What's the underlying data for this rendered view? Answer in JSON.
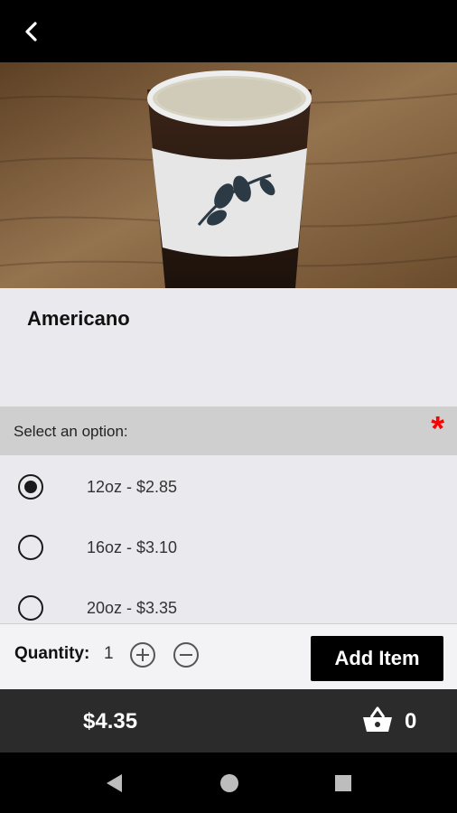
{
  "header": {
    "back_icon": "chevron-left-icon"
  },
  "hero": {
    "image_subject": "coffee glass with sleeve on wooden table"
  },
  "product": {
    "title": "Americano"
  },
  "options": {
    "header_label": "Select an option:",
    "required_mark": "*",
    "items": [
      {
        "label": "12oz - $2.85",
        "selected": true
      },
      {
        "label": "16oz - $3.10",
        "selected": false
      },
      {
        "label": "20oz - $3.35",
        "selected": false
      }
    ]
  },
  "quantity": {
    "label": "Quantity:",
    "value": "1",
    "increase_icon": "plus-circle-icon",
    "decrease_icon": "minus-circle-icon"
  },
  "actions": {
    "add_item_label": "Add Item"
  },
  "cart": {
    "total": "$4.35",
    "count": "0",
    "icon": "basket-icon"
  },
  "system_nav": {
    "back_icon": "triangle-back-icon",
    "home_icon": "circle-home-icon",
    "recents_icon": "square-recents-icon"
  },
  "colors": {
    "top_bar": "#000000",
    "required": "#ff0000",
    "total_bar": "#2b2b2b",
    "add_button": "#000000"
  }
}
